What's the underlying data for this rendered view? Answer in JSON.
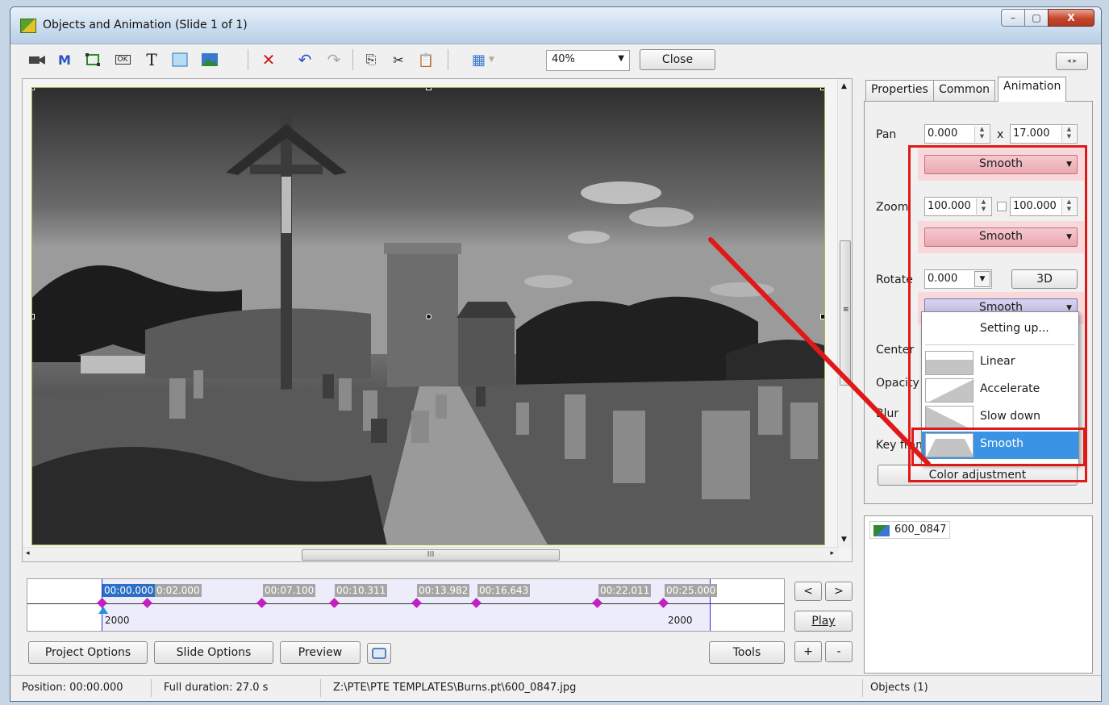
{
  "window": {
    "title": "Objects and Animation  (Slide 1 of 1)",
    "controls": {
      "minimize": "–",
      "maximize": "▢",
      "close": "X"
    }
  },
  "toolbar": {
    "zoom": "40%",
    "close_label": "Close",
    "icons": [
      "camera-icon",
      "mask-icon",
      "frame-icon",
      "button-icon",
      "text-icon",
      "rectangle-icon",
      "image-icon",
      "delete-icon",
      "undo-icon",
      "redo-icon",
      "copy-icon",
      "cut-icon",
      "paste-icon",
      "grid-icon"
    ],
    "glyphs": {
      "mask": "M",
      "button": "OK",
      "text": "T",
      "delete": "✕",
      "undo": "↶",
      "redo": "↷",
      "copy": "⎘",
      "cut": "✂",
      "paste": "📋",
      "grid": "▦",
      "nav_left": "◂",
      "nav_right": "▸"
    }
  },
  "canvas": {
    "hscroll_grip": "III",
    "vscroll_grip": "≡"
  },
  "timeline": {
    "markers": [
      "00:00.000",
      "0:02.000",
      "00:07.100",
      "00:10.311",
      "00:13.982",
      "00:16.643",
      "00:22.011",
      "00:25.000"
    ],
    "active_marker": "00:00.000",
    "left_value": "2000",
    "right_value": "2000"
  },
  "nav": {
    "prev": "<",
    "next": ">",
    "play": "Play",
    "plus": "+",
    "minus": "-"
  },
  "bottom_buttons": {
    "project_options": "Project Options",
    "slide_options": "Slide Options",
    "preview": "Preview",
    "tools": "Tools"
  },
  "tabs": [
    {
      "label": "Properties",
      "active": false
    },
    {
      "label": "Common",
      "active": false
    },
    {
      "label": "Animation",
      "active": true
    }
  ],
  "animation": {
    "pan_label": "Pan",
    "pan_x": "0.000",
    "pan_sep": "x",
    "pan_y": "17.000",
    "pan_mode": "Smooth",
    "zoom_label": "Zoom",
    "zoom_x": "100.000",
    "zoom_y": "100.000",
    "zoom_mode": "Smooth",
    "rotate_label": "Rotate",
    "rotate_value": "0.000",
    "rotate_3d": "3D",
    "rotate_mode": "Smooth",
    "center_label": "Center",
    "opacity_label": "Opacity",
    "blur_label": "Blur",
    "keyframe_label": "Key frame",
    "color_adjustment": "Color adjustment"
  },
  "dropdown": {
    "setting_up": "Setting up...",
    "options": [
      "Linear",
      "Accelerate",
      "Slow down",
      "Smooth"
    ],
    "selected": "Smooth"
  },
  "objects": {
    "item": "600_0847"
  },
  "status": {
    "position": "Position:  00:00.000",
    "duration": "Full duration:  27.0 s",
    "path": "Z:\\PTE\\PTE TEMPLATES\\Burns.pt\\600_0847.jpg",
    "objects": "Objects (1)"
  },
  "colors": {
    "annotation_red": "#e01818",
    "selected_blue": "#3b93e6",
    "smooth_pink": "#eaa8b0",
    "timeline_band": "#ececfb",
    "keyframe_magenta": "#c021c0"
  }
}
